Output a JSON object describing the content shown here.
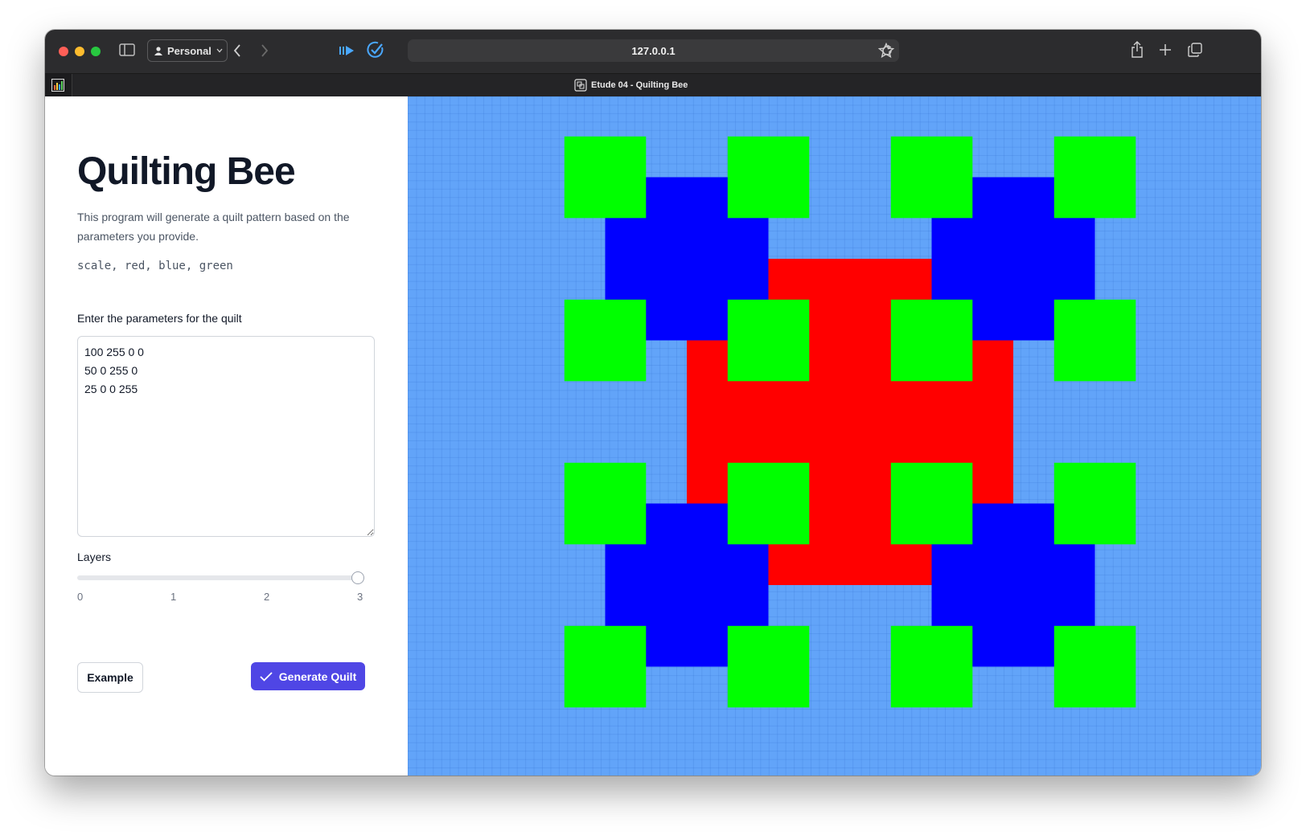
{
  "browser": {
    "profile_label": "Personal",
    "url": "127.0.0.1",
    "tab_title": "Etude 04 - Quilting Bee",
    "icons": [
      "sidebar-icon",
      "person-icon",
      "chevron-down-icon",
      "back-icon",
      "forward-icon",
      "media-icon",
      "checkmark-circle-icon",
      "reload-icon",
      "star-icon",
      "share-icon",
      "plus-icon",
      "tabs-icon",
      "chart-icon",
      "page-icon"
    ],
    "colors": {
      "close": "#ff5f57",
      "minimize": "#febc2e",
      "zoom": "#28c840"
    }
  },
  "page": {
    "title": "Quilting Bee",
    "description": "This program will generate a quilt pattern based on the parameters you provide.",
    "format_hint": "scale, red, blue, green",
    "params_label": "Enter the parameters for the quilt",
    "params_value": "100 255 0 0\n50 0 255 0\n25 0 0 255",
    "layers_label": "Layers",
    "layers_ticks": [
      "0",
      "1",
      "2",
      "3"
    ],
    "layers_value": 3,
    "example_button": "Example",
    "generate_button": "Generate Quilt",
    "accent_color": "#4f46e5"
  },
  "quilt": {
    "background": "#62a4f9",
    "layers": [
      {
        "scale": 100,
        "color": "#ff0000"
      },
      {
        "scale": 50,
        "color": "#0000ff"
      },
      {
        "scale": 25,
        "color": "#00ff00"
      }
    ]
  }
}
